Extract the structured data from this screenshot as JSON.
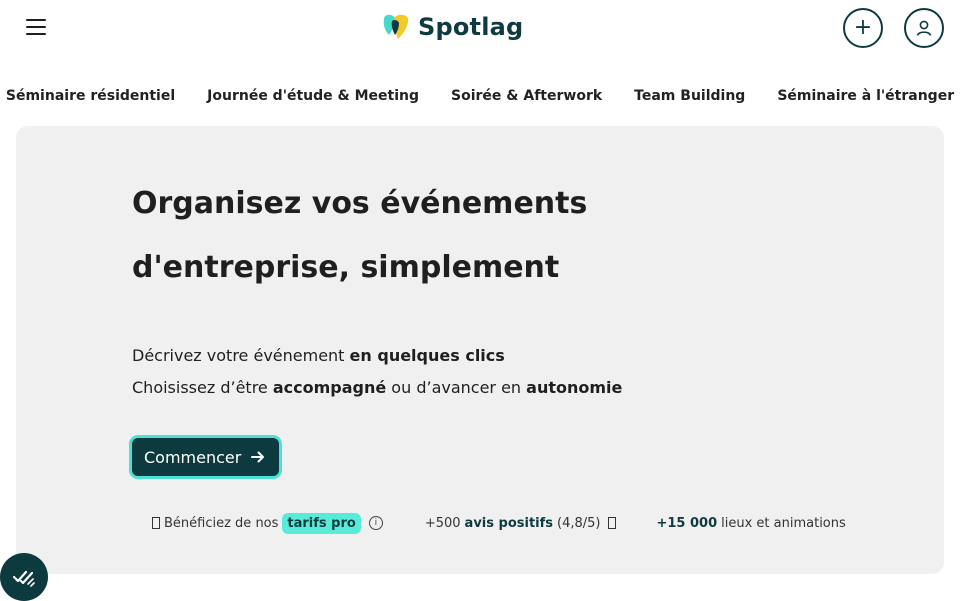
{
  "header": {
    "logo_text": "Spotlag",
    "menu_icon": "hamburger-menu-icon",
    "plus_icon": "plus-icon",
    "user_icon": "user-icon"
  },
  "nav": {
    "items": [
      {
        "label": "Séminaire résidentiel"
      },
      {
        "label": "Journée d'étude & Meeting"
      },
      {
        "label": "Soirée & Afterwork"
      },
      {
        "label": "Team Building"
      },
      {
        "label": "Séminaire à l'étranger"
      }
    ]
  },
  "hero": {
    "title_line1": "Organisez vos événements",
    "title_line2": "d'entreprise, simplement",
    "line1_prefix": "Décrivez votre événement ",
    "line1_bold": "en quelques clics",
    "line2_prefix": "Choisissez d’être ",
    "line2_bold1": "accompagné",
    "line2_mid": " ou d’avancer en ",
    "line2_bold2": "autonomie",
    "cta_label": "Commencer",
    "cta_icon": "arrow-right-icon"
  },
  "badges": {
    "b1_prefix": "Bénéficiez de nos ",
    "b1_pill": "tarifs pro",
    "b2_prefix": "+500 ",
    "b2_bold": "avis positifs",
    "b2_suffix": " (4,8/5)",
    "b3_bold": "+15 000",
    "b3_suffix": " lieux et animations"
  },
  "colors": {
    "brand_dark": "#0c3a3f",
    "accent": "#58ecd8",
    "hero_bg": "#f0f0f0"
  }
}
